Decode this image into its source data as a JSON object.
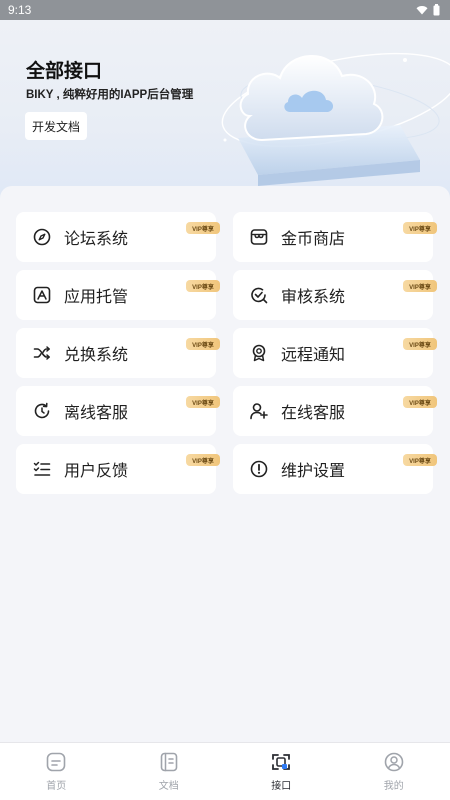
{
  "status_bar": {
    "time": "9:13"
  },
  "hero": {
    "title": "全部接口",
    "subtitle": "BIKY , 纯粹好用的IAPP后台管理",
    "doc_button": "开发文档"
  },
  "vip_badge": "VIP尊享",
  "menu": [
    {
      "label": "论坛系统",
      "icon": "compass-icon",
      "vip": "VIP尊享"
    },
    {
      "label": "金币商店",
      "icon": "store-icon",
      "vip": "VIP尊享"
    },
    {
      "label": "应用托管",
      "icon": "app-box-icon",
      "vip": "VIP尊享"
    },
    {
      "label": "审核系统",
      "icon": "audit-check-icon",
      "vip": "VIP尊享"
    },
    {
      "label": "兑换系统",
      "icon": "shuffle-icon",
      "vip": "VIP尊享"
    },
    {
      "label": "远程通知",
      "icon": "badge-icon",
      "vip": "VIP尊享"
    },
    {
      "label": "离线客服",
      "icon": "refresh-clock-icon",
      "vip": "VIP尊享"
    },
    {
      "label": "在线客服",
      "icon": "user-add-icon",
      "vip": "VIP尊享"
    },
    {
      "label": "用户反馈",
      "icon": "checklist-icon",
      "vip": "VIP尊享"
    },
    {
      "label": "维护设置",
      "icon": "alert-circle-icon",
      "vip": "VIP尊享"
    }
  ],
  "tabbar": [
    {
      "label": "首页",
      "icon": "home-icon",
      "active": false
    },
    {
      "label": "文档",
      "icon": "document-icon",
      "active": false
    },
    {
      "label": "接口",
      "icon": "interface-icon",
      "active": true
    },
    {
      "label": "我的",
      "icon": "profile-icon",
      "active": false
    }
  ]
}
